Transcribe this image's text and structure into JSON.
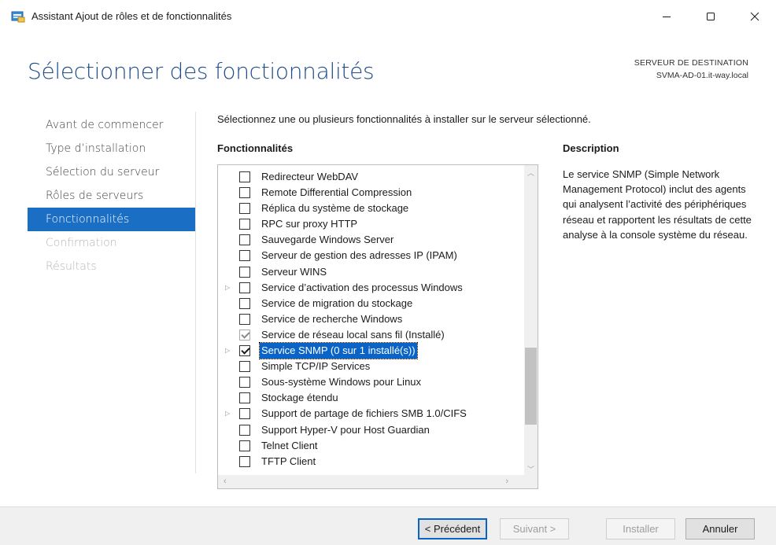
{
  "window": {
    "title": "Assistant Ajout de rôles et de fonctionnalités",
    "minimize_glyph": "—",
    "maximize_glyph": "☐",
    "close_glyph": "✕"
  },
  "header": {
    "page_title": "Sélectionner des fonctionnalités",
    "destination_label": "SERVEUR DE DESTINATION",
    "destination_server": "SVMA-AD-01.it-way.local"
  },
  "nav": {
    "items": [
      {
        "label": "Avant de commencer",
        "state": "normal"
      },
      {
        "label": "Type d’installation",
        "state": "normal"
      },
      {
        "label": "Sélection du serveur",
        "state": "normal"
      },
      {
        "label": "Rôles de serveurs",
        "state": "normal"
      },
      {
        "label": "Fonctionnalités",
        "state": "active"
      },
      {
        "label": "Confirmation",
        "state": "disabled"
      },
      {
        "label": "Résultats",
        "state": "disabled"
      }
    ]
  },
  "main": {
    "intro": "Sélectionnez une ou plusieurs fonctionnalités à installer sur le serveur sélectionné.",
    "features_heading": "Fonctionnalités",
    "description_heading": "Description",
    "description": "Le service SNMP (Simple Network Management Protocol) inclut des agents qui analysent l’activité des périphériques réseau et rapportent les résultats de cette analyse à la console système du réseau.",
    "features": [
      {
        "label": "Redirecteur WebDAV",
        "checked": false,
        "expandable": false
      },
      {
        "label": "Remote Differential Compression",
        "checked": false,
        "expandable": false
      },
      {
        "label": "Réplica du système de stockage",
        "checked": false,
        "expandable": false
      },
      {
        "label": "RPC sur proxy HTTP",
        "checked": false,
        "expandable": false
      },
      {
        "label": "Sauvegarde Windows Server",
        "checked": false,
        "expandable": false
      },
      {
        "label": "Serveur de gestion des adresses IP (IPAM)",
        "checked": false,
        "expandable": false
      },
      {
        "label": "Serveur WINS",
        "checked": false,
        "expandable": false
      },
      {
        "label": "Service d’activation des processus Windows",
        "checked": false,
        "expandable": true
      },
      {
        "label": "Service de migration du stockage",
        "checked": false,
        "expandable": false
      },
      {
        "label": "Service de recherche Windows",
        "checked": false,
        "expandable": false
      },
      {
        "label": "Service de réseau local sans fil (Installé)",
        "checked": true,
        "installed": true,
        "expandable": false
      },
      {
        "label": "Service SNMP (0 sur 1 installé(s))",
        "checked": true,
        "selected": true,
        "expandable": true
      },
      {
        "label": "Simple TCP/IP Services",
        "checked": false,
        "expandable": false
      },
      {
        "label": "Sous-système Windows pour Linux",
        "checked": false,
        "expandable": false
      },
      {
        "label": "Stockage étendu",
        "checked": false,
        "expandable": false
      },
      {
        "label": "Support de partage de fichiers SMB 1.0/CIFS",
        "checked": false,
        "expandable": true
      },
      {
        "label": "Support Hyper-V pour Host Guardian",
        "checked": false,
        "expandable": false
      },
      {
        "label": "Telnet Client",
        "checked": false,
        "expandable": false
      },
      {
        "label": "TFTP Client",
        "checked": false,
        "expandable": false
      }
    ]
  },
  "footer": {
    "previous": "< Précédent",
    "next": "Suivant >",
    "install": "Installer",
    "cancel": "Annuler"
  },
  "colors": {
    "title_blue": "#1e4d8a",
    "nav_active": "#1a6fc4",
    "selection": "#0a64c8"
  }
}
